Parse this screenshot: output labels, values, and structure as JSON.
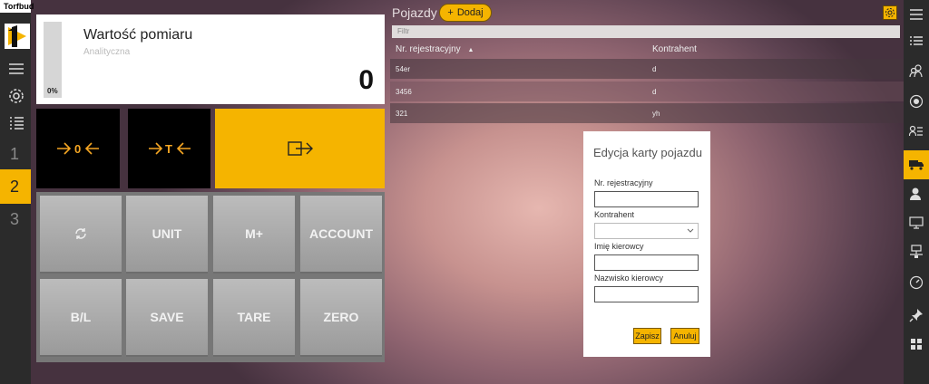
{
  "app": {
    "title": "Torfbud"
  },
  "left_nav": {
    "numbers": [
      "1",
      "2",
      "3"
    ],
    "active_index": 1
  },
  "measurement": {
    "title": "Wartość pomiaru",
    "subtitle": "Analityczna",
    "percent": "0%",
    "value": "0"
  },
  "function_buttons": {
    "zero_icon": "zero-arrows-icon",
    "tare_icon": "tare-arrows-icon",
    "exit_icon": "exit-arrow-icon"
  },
  "grid_buttons": [
    "UNIT",
    "M+",
    "ACCOUNT",
    "B/L",
    "SAVE",
    "TARE",
    "ZERO"
  ],
  "vehicles": {
    "title": "Pojazdy",
    "add_label": "Dodaj",
    "filter_placeholder": "Filtr",
    "columns": [
      "Nr. rejestracyjny",
      "Kontrahent"
    ],
    "rows": [
      {
        "reg": "54er",
        "contractor": "d"
      },
      {
        "reg": "3456",
        "contractor": "d"
      },
      {
        "reg": "321",
        "contractor": "yh"
      }
    ]
  },
  "dialog": {
    "title": "Edycja karty pojazdu",
    "fields": {
      "reg_label": "Nr. rejestracyjny",
      "contractor_label": "Kontrahent",
      "driver_first_label": "Imię kierowcy",
      "driver_last_label": "Nazwisko kierowcy"
    },
    "save_label": "Zapisz",
    "cancel_label": "Anuluj"
  },
  "colors": {
    "accent": "#f5b400",
    "nav": "#2b2b2b",
    "fn_orange": "#f5a623"
  }
}
